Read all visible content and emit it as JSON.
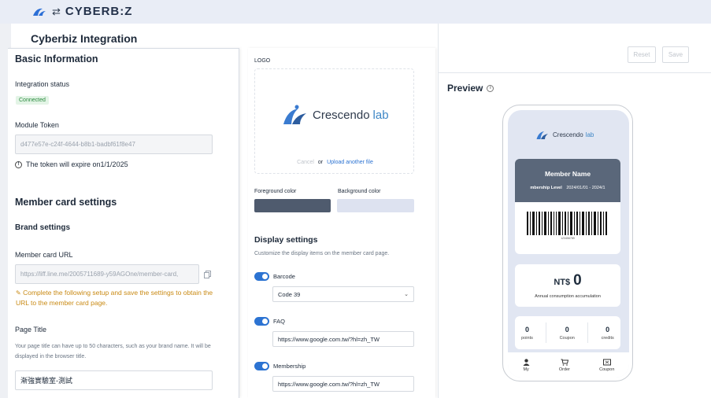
{
  "header": {
    "brand": "CYBERB:Z"
  },
  "page_title": "Cyberbiz Integration",
  "basic": {
    "title": "Basic Information",
    "status_label": "Integration status",
    "status_value": "Connected",
    "token_label": "Module Token",
    "token_value": "d477e57e-c24f-4644-b8b1-badbf61f8e47",
    "token_note": "The token will expire on1/1/2025"
  },
  "member": {
    "title": "Member card settings",
    "brand_title": "Brand settings",
    "url_label": "Member card URL",
    "url_value": "https://liff.line.me/2005711689-y59AGOne/member-card,",
    "warning": "Complete the following setup and save the settings to obtain the URL to the member card page.",
    "page_title_label": "Page Title",
    "page_title_help": "Your page title can have up to 50 characters, such as your brand name. It will be displayed in the browser title.",
    "page_title_value": "漸強實驗室-測試"
  },
  "logo": {
    "label": "LOGO",
    "brand_word": "Crescendo",
    "brand_lab": "lab",
    "cancel": "Cancel",
    "or": "or",
    "upload": "Upload another file"
  },
  "colors": {
    "fg_label": "Foreground color",
    "bg_label": "Background color",
    "fg": "#4f5b6e",
    "bg": "#dde2f0"
  },
  "display": {
    "title": "Display settings",
    "subtitle": "Customize the display items on the member card page.",
    "barcode_label": "Barcode",
    "barcode_value": "Code 39",
    "faq_label": "FAQ",
    "faq_value": "https://www.google.com.tw/?hl=zh_TW",
    "membership_label": "Membership",
    "membership_value": "https://www.google.com.tw/?hl=zh_TW"
  },
  "actions": {
    "reset": "Reset",
    "save": "Save"
  },
  "preview": {
    "title": "Preview",
    "member_name": "Member Name",
    "membership_level": "mbership Level",
    "period": "2024/01/01 - 2024/1",
    "barcode_text": "123456789",
    "currency": "NT$",
    "amount": "0",
    "amount_caption": "Annual consumption accumulation",
    "points_value": "0",
    "points_label": "points",
    "coupon_value": "0",
    "coupon_label": "Coupon",
    "credits_value": "0",
    "credits_label": "credits",
    "tabs": [
      "My",
      "Order",
      "Coupon"
    ]
  }
}
